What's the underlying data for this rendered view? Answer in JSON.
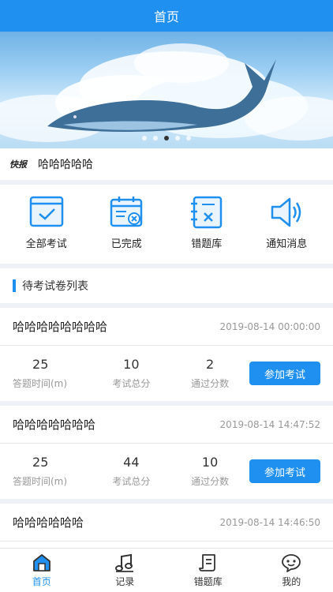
{
  "header": {
    "title": "首页"
  },
  "banner": {
    "slide_count": 5,
    "active_index": 2
  },
  "news": {
    "tag": "快报",
    "text": "哈哈哈哈哈"
  },
  "quick_actions": [
    {
      "label": "全部考试",
      "icon": "exam-list-icon"
    },
    {
      "label": "已完成",
      "icon": "calendar-check-icon"
    },
    {
      "label": "错题库",
      "icon": "notebook-wrong-icon"
    },
    {
      "label": "通知消息",
      "icon": "speaker-icon"
    }
  ],
  "section": {
    "title": "待考试卷列表"
  },
  "exams": [
    {
      "title": "哈哈哈哈哈哈哈哈",
      "time": "2019-08-14 00:00:00",
      "duration": "25",
      "duration_label": "答题时间(m)",
      "total": "10",
      "total_label": "考试总分",
      "pass": "2",
      "pass_label": "通过分数",
      "button": "参加考试"
    },
    {
      "title": "哈哈哈哈哈哈哈",
      "time": "2019-08-14 14:47:52",
      "duration": "25",
      "duration_label": "答题时间(m)",
      "total": "44",
      "total_label": "考试总分",
      "pass": "10",
      "pass_label": "通过分数",
      "button": "参加考试"
    },
    {
      "title": "哈哈哈哈哈哈",
      "time": "2019-08-14 14:46:50"
    }
  ],
  "tabs": [
    {
      "label": "首页",
      "icon": "home-icon",
      "active": true
    },
    {
      "label": "记录",
      "icon": "music-note-icon",
      "active": false
    },
    {
      "label": "错题库",
      "icon": "scroll-icon",
      "active": false
    },
    {
      "label": "我的",
      "icon": "chat-face-icon",
      "active": false
    }
  ],
  "colors": {
    "primary": "#1f8ff0",
    "background": "#eef1f5"
  }
}
